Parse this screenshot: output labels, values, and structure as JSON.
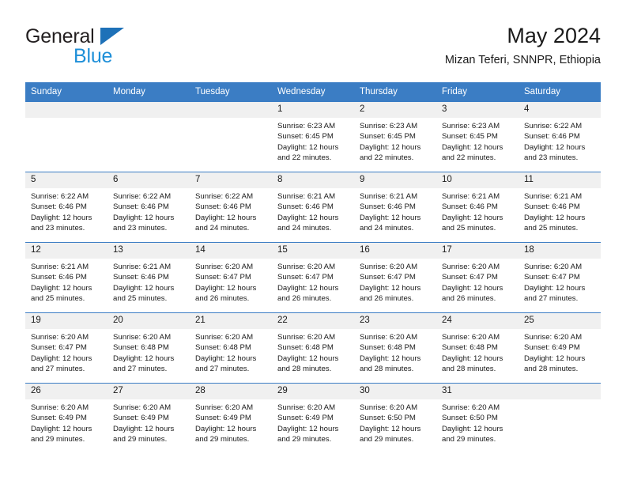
{
  "brand": {
    "word_one": "General",
    "word_two": "Blue",
    "triangle_color": "#1e71b8",
    "blue_color": "#1e8fd8"
  },
  "header": {
    "title": "May 2024",
    "subtitle": "Mizan Teferi, SNNPR, Ethiopia"
  },
  "theme": {
    "header_blue": "#3b7dc4",
    "daynum_gray": "#f0f0f0"
  },
  "weekday_headers": [
    "Sunday",
    "Monday",
    "Tuesday",
    "Wednesday",
    "Thursday",
    "Friday",
    "Saturday"
  ],
  "weeks": [
    [
      {
        "day": "",
        "empty": true,
        "sunrise": "",
        "sunset": "",
        "daylight_line1": "",
        "daylight_line2": ""
      },
      {
        "day": "",
        "empty": true,
        "sunrise": "",
        "sunset": "",
        "daylight_line1": "",
        "daylight_line2": ""
      },
      {
        "day": "",
        "empty": true,
        "sunrise": "",
        "sunset": "",
        "daylight_line1": "",
        "daylight_line2": ""
      },
      {
        "day": "1",
        "empty": false,
        "sunrise": "Sunrise: 6:23 AM",
        "sunset": "Sunset: 6:45 PM",
        "daylight_line1": "Daylight: 12 hours",
        "daylight_line2": "and 22 minutes."
      },
      {
        "day": "2",
        "empty": false,
        "sunrise": "Sunrise: 6:23 AM",
        "sunset": "Sunset: 6:45 PM",
        "daylight_line1": "Daylight: 12 hours",
        "daylight_line2": "and 22 minutes."
      },
      {
        "day": "3",
        "empty": false,
        "sunrise": "Sunrise: 6:23 AM",
        "sunset": "Sunset: 6:45 PM",
        "daylight_line1": "Daylight: 12 hours",
        "daylight_line2": "and 22 minutes."
      },
      {
        "day": "4",
        "empty": false,
        "sunrise": "Sunrise: 6:22 AM",
        "sunset": "Sunset: 6:46 PM",
        "daylight_line1": "Daylight: 12 hours",
        "daylight_line2": "and 23 minutes."
      }
    ],
    [
      {
        "day": "5",
        "empty": false,
        "sunrise": "Sunrise: 6:22 AM",
        "sunset": "Sunset: 6:46 PM",
        "daylight_line1": "Daylight: 12 hours",
        "daylight_line2": "and 23 minutes."
      },
      {
        "day": "6",
        "empty": false,
        "sunrise": "Sunrise: 6:22 AM",
        "sunset": "Sunset: 6:46 PM",
        "daylight_line1": "Daylight: 12 hours",
        "daylight_line2": "and 23 minutes."
      },
      {
        "day": "7",
        "empty": false,
        "sunrise": "Sunrise: 6:22 AM",
        "sunset": "Sunset: 6:46 PM",
        "daylight_line1": "Daylight: 12 hours",
        "daylight_line2": "and 24 minutes."
      },
      {
        "day": "8",
        "empty": false,
        "sunrise": "Sunrise: 6:21 AM",
        "sunset": "Sunset: 6:46 PM",
        "daylight_line1": "Daylight: 12 hours",
        "daylight_line2": "and 24 minutes."
      },
      {
        "day": "9",
        "empty": false,
        "sunrise": "Sunrise: 6:21 AM",
        "sunset": "Sunset: 6:46 PM",
        "daylight_line1": "Daylight: 12 hours",
        "daylight_line2": "and 24 minutes."
      },
      {
        "day": "10",
        "empty": false,
        "sunrise": "Sunrise: 6:21 AM",
        "sunset": "Sunset: 6:46 PM",
        "daylight_line1": "Daylight: 12 hours",
        "daylight_line2": "and 25 minutes."
      },
      {
        "day": "11",
        "empty": false,
        "sunrise": "Sunrise: 6:21 AM",
        "sunset": "Sunset: 6:46 PM",
        "daylight_line1": "Daylight: 12 hours",
        "daylight_line2": "and 25 minutes."
      }
    ],
    [
      {
        "day": "12",
        "empty": false,
        "sunrise": "Sunrise: 6:21 AM",
        "sunset": "Sunset: 6:46 PM",
        "daylight_line1": "Daylight: 12 hours",
        "daylight_line2": "and 25 minutes."
      },
      {
        "day": "13",
        "empty": false,
        "sunrise": "Sunrise: 6:21 AM",
        "sunset": "Sunset: 6:46 PM",
        "daylight_line1": "Daylight: 12 hours",
        "daylight_line2": "and 25 minutes."
      },
      {
        "day": "14",
        "empty": false,
        "sunrise": "Sunrise: 6:20 AM",
        "sunset": "Sunset: 6:47 PM",
        "daylight_line1": "Daylight: 12 hours",
        "daylight_line2": "and 26 minutes."
      },
      {
        "day": "15",
        "empty": false,
        "sunrise": "Sunrise: 6:20 AM",
        "sunset": "Sunset: 6:47 PM",
        "daylight_line1": "Daylight: 12 hours",
        "daylight_line2": "and 26 minutes."
      },
      {
        "day": "16",
        "empty": false,
        "sunrise": "Sunrise: 6:20 AM",
        "sunset": "Sunset: 6:47 PM",
        "daylight_line1": "Daylight: 12 hours",
        "daylight_line2": "and 26 minutes."
      },
      {
        "day": "17",
        "empty": false,
        "sunrise": "Sunrise: 6:20 AM",
        "sunset": "Sunset: 6:47 PM",
        "daylight_line1": "Daylight: 12 hours",
        "daylight_line2": "and 26 minutes."
      },
      {
        "day": "18",
        "empty": false,
        "sunrise": "Sunrise: 6:20 AM",
        "sunset": "Sunset: 6:47 PM",
        "daylight_line1": "Daylight: 12 hours",
        "daylight_line2": "and 27 minutes."
      }
    ],
    [
      {
        "day": "19",
        "empty": false,
        "sunrise": "Sunrise: 6:20 AM",
        "sunset": "Sunset: 6:47 PM",
        "daylight_line1": "Daylight: 12 hours",
        "daylight_line2": "and 27 minutes."
      },
      {
        "day": "20",
        "empty": false,
        "sunrise": "Sunrise: 6:20 AM",
        "sunset": "Sunset: 6:48 PM",
        "daylight_line1": "Daylight: 12 hours",
        "daylight_line2": "and 27 minutes."
      },
      {
        "day": "21",
        "empty": false,
        "sunrise": "Sunrise: 6:20 AM",
        "sunset": "Sunset: 6:48 PM",
        "daylight_line1": "Daylight: 12 hours",
        "daylight_line2": "and 27 minutes."
      },
      {
        "day": "22",
        "empty": false,
        "sunrise": "Sunrise: 6:20 AM",
        "sunset": "Sunset: 6:48 PM",
        "daylight_line1": "Daylight: 12 hours",
        "daylight_line2": "and 28 minutes."
      },
      {
        "day": "23",
        "empty": false,
        "sunrise": "Sunrise: 6:20 AM",
        "sunset": "Sunset: 6:48 PM",
        "daylight_line1": "Daylight: 12 hours",
        "daylight_line2": "and 28 minutes."
      },
      {
        "day": "24",
        "empty": false,
        "sunrise": "Sunrise: 6:20 AM",
        "sunset": "Sunset: 6:48 PM",
        "daylight_line1": "Daylight: 12 hours",
        "daylight_line2": "and 28 minutes."
      },
      {
        "day": "25",
        "empty": false,
        "sunrise": "Sunrise: 6:20 AM",
        "sunset": "Sunset: 6:49 PM",
        "daylight_line1": "Daylight: 12 hours",
        "daylight_line2": "and 28 minutes."
      }
    ],
    [
      {
        "day": "26",
        "empty": false,
        "sunrise": "Sunrise: 6:20 AM",
        "sunset": "Sunset: 6:49 PM",
        "daylight_line1": "Daylight: 12 hours",
        "daylight_line2": "and 29 minutes."
      },
      {
        "day": "27",
        "empty": false,
        "sunrise": "Sunrise: 6:20 AM",
        "sunset": "Sunset: 6:49 PM",
        "daylight_line1": "Daylight: 12 hours",
        "daylight_line2": "and 29 minutes."
      },
      {
        "day": "28",
        "empty": false,
        "sunrise": "Sunrise: 6:20 AM",
        "sunset": "Sunset: 6:49 PM",
        "daylight_line1": "Daylight: 12 hours",
        "daylight_line2": "and 29 minutes."
      },
      {
        "day": "29",
        "empty": false,
        "sunrise": "Sunrise: 6:20 AM",
        "sunset": "Sunset: 6:49 PM",
        "daylight_line1": "Daylight: 12 hours",
        "daylight_line2": "and 29 minutes."
      },
      {
        "day": "30",
        "empty": false,
        "sunrise": "Sunrise: 6:20 AM",
        "sunset": "Sunset: 6:50 PM",
        "daylight_line1": "Daylight: 12 hours",
        "daylight_line2": "and 29 minutes."
      },
      {
        "day": "31",
        "empty": false,
        "sunrise": "Sunrise: 6:20 AM",
        "sunset": "Sunset: 6:50 PM",
        "daylight_line1": "Daylight: 12 hours",
        "daylight_line2": "and 29 minutes."
      },
      {
        "day": "",
        "empty": true,
        "sunrise": "",
        "sunset": "",
        "daylight_line1": "",
        "daylight_line2": ""
      }
    ]
  ]
}
